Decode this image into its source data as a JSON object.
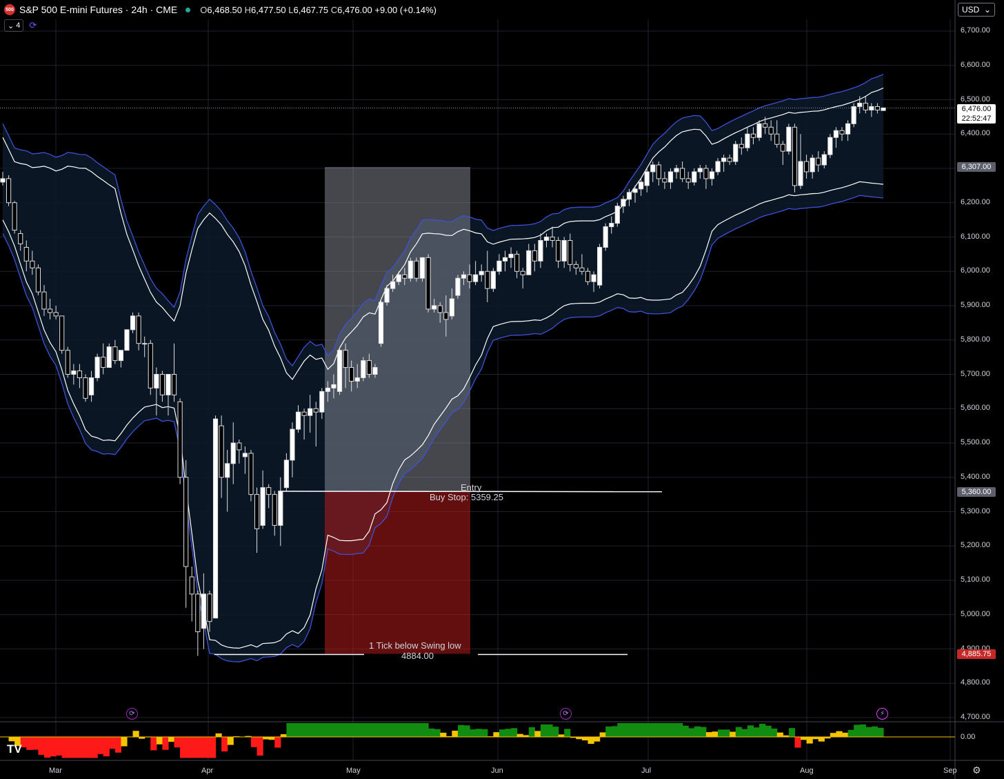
{
  "header": {
    "symbol_badge": "500",
    "title": "S&P 500 E-mini Futures · 24h · CME",
    "ohlc": {
      "o_label": "O",
      "o": "6,468.50",
      "h_label": "H",
      "h": "6,477.50",
      "l_label": "L",
      "l": "6,467.75",
      "c_label": "C",
      "c": "6,476.00",
      "change": "+9.00 (+0.14%)"
    },
    "indicator_count": "4",
    "currency": "USD",
    "up_color": "#ffffff",
    "down_color": "#000000",
    "band_color": "#3f51d8"
  },
  "price_tags": {
    "last_price": "6,476.00",
    "countdown": "22:52:47",
    "level_high": "6,307.00",
    "level_entry": "5,360.00",
    "level_stop": "4,885.75"
  },
  "annotations": {
    "entry_title": "Entry",
    "entry_text": "Buy Stop: 5359.25",
    "stop_title": "1 Tick below Swing low",
    "stop_value": "4884.00"
  },
  "chart_data": {
    "type": "candlestick",
    "title": "S&P 500 E-mini Futures · 24h · CME",
    "ylim": [
      4650,
      6750
    ],
    "yticks": [
      4700,
      4800,
      4900,
      5000,
      5100,
      5200,
      5300,
      5400,
      5500,
      5600,
      5700,
      5800,
      5900,
      6000,
      6100,
      6200,
      6300,
      6400,
      6500,
      6600,
      6700
    ],
    "ytick_labels": [
      "4,700.00",
      "4,800.00",
      "4,900.00",
      "5,000.00",
      "5,100.00",
      "5,200.00",
      "5,300.00",
      "5,400.00",
      "5,500.00",
      "5,600.00",
      "5,700.00",
      "5,800.00",
      "5,900.00",
      "6,000.00",
      "6,100.00",
      "6,200.00",
      "6,300.00",
      "6,400.00",
      "6,500.00",
      "6,600.00",
      "6,700.00"
    ],
    "xtick_labels": [
      "Mar",
      "Apr",
      "May",
      "Jun",
      "Jul",
      "Aug",
      "Sep"
    ],
    "xtick_pos": [
      81,
      302,
      512,
      722,
      940,
      1170,
      1378
    ],
    "candles": [
      [
        6260,
        6290,
        6250,
        6270
      ],
      [
        6270,
        6280,
        6190,
        6200
      ],
      [
        6200,
        6205,
        6110,
        6120
      ],
      [
        6110,
        6120,
        6060,
        6080
      ],
      [
        6070,
        6090,
        6000,
        6030
      ],
      [
        6030,
        6060,
        5990,
        6010
      ],
      [
        6010,
        6020,
        5930,
        5940
      ],
      [
        5940,
        5960,
        5870,
        5890
      ],
      [
        5890,
        5920,
        5860,
        5880
      ],
      [
        5880,
        5900,
        5860,
        5870
      ],
      [
        5870,
        5870,
        5760,
        5770
      ],
      [
        5770,
        5780,
        5690,
        5700
      ],
      [
        5700,
        5730,
        5670,
        5710
      ],
      [
        5710,
        5730,
        5660,
        5690
      ],
      [
        5690,
        5700,
        5620,
        5630
      ],
      [
        5640,
        5710,
        5620,
        5690
      ],
      [
        5690,
        5760,
        5680,
        5750
      ],
      [
        5750,
        5790,
        5700,
        5720
      ],
      [
        5720,
        5790,
        5720,
        5780
      ],
      [
        5780,
        5800,
        5730,
        5740
      ],
      [
        5740,
        5770,
        5720,
        5770
      ],
      [
        5770,
        5830,
        5770,
        5830
      ],
      [
        5830,
        5880,
        5820,
        5870
      ],
      [
        5870,
        5880,
        5770,
        5790
      ],
      [
        5790,
        5810,
        5750,
        5790
      ],
      [
        5790,
        5800,
        5640,
        5660
      ],
      [
        5660,
        5720,
        5580,
        5700
      ],
      [
        5700,
        5710,
        5620,
        5640
      ],
      [
        5640,
        5700,
        5580,
        5700
      ],
      [
        5700,
        5790,
        5620,
        5640
      ],
      [
        5620,
        5630,
        5380,
        5400
      ],
      [
        5400,
        5450,
        5020,
        5140
      ],
      [
        5110,
        5140,
        4980,
        5060
      ],
      [
        5060,
        5070,
        4880,
        4950
      ],
      [
        4960,
        5120,
        4900,
        5060
      ],
      [
        5060,
        5070,
        4950,
        4980
      ],
      [
        4990,
        5580,
        4990,
        5570
      ],
      [
        5550,
        5580,
        5340,
        5400
      ],
      [
        5400,
        5480,
        5300,
        5440
      ],
      [
        5440,
        5560,
        5380,
        5500
      ],
      [
        5500,
        5510,
        5440,
        5480
      ],
      [
        5460,
        5490,
        5410,
        5470
      ],
      [
        5470,
        5480,
        5330,
        5350
      ],
      [
        5350,
        5370,
        5180,
        5250
      ],
      [
        5260,
        5420,
        5250,
        5370
      ],
      [
        5370,
        5380,
        5310,
        5350
      ],
      [
        5350,
        5360,
        5230,
        5260
      ],
      [
        5260,
        5400,
        5200,
        5360
      ],
      [
        5370,
        5470,
        5360,
        5450
      ],
      [
        5450,
        5560,
        5400,
        5540
      ],
      [
        5540,
        5610,
        5530,
        5590
      ],
      [
        5590,
        5600,
        5510,
        5580
      ],
      [
        5580,
        5640,
        5530,
        5600
      ],
      [
        5600,
        5620,
        5490,
        5590
      ],
      [
        5590,
        5660,
        5570,
        5650
      ],
      [
        5650,
        5680,
        5620,
        5660
      ],
      [
        5660,
        5700,
        5630,
        5670
      ],
      [
        5650,
        5780,
        5640,
        5770
      ],
      [
        5770,
        5790,
        5660,
        5720
      ],
      [
        5720,
        5740,
        5650,
        5680
      ],
      [
        5680,
        5730,
        5660,
        5690
      ],
      [
        5690,
        5750,
        5680,
        5740
      ],
      [
        5740,
        5760,
        5690,
        5700
      ],
      [
        5700,
        5730,
        5690,
        5720
      ],
      [
        5790,
        5920,
        5780,
        5910
      ],
      [
        5910,
        5960,
        5900,
        5950
      ],
      [
        5950,
        5990,
        5940,
        5970
      ],
      [
        5970,
        6000,
        5960,
        5990
      ],
      [
        5990,
        6010,
        5960,
        5980
      ],
      [
        5980,
        6040,
        5970,
        6030
      ],
      [
        6030,
        6040,
        5970,
        5980
      ],
      [
        5980,
        6020,
        5970,
        6040
      ],
      [
        6040,
        6050,
        5880,
        5890
      ],
      [
        5890,
        5920,
        5880,
        5900
      ],
      [
        5900,
        5910,
        5850,
        5880
      ],
      [
        5880,
        5930,
        5810,
        5860
      ],
      [
        5870,
        5950,
        5860,
        5920
      ],
      [
        5930,
        5990,
        5920,
        5980
      ],
      [
        5980,
        6000,
        5960,
        5990
      ],
      [
        5990,
        6020,
        5950,
        5970
      ],
      [
        5970,
        6030,
        5960,
        5990
      ],
      [
        5990,
        6020,
        5970,
        6000
      ],
      [
        6000,
        6060,
        5910,
        5950
      ],
      [
        5950,
        6010,
        5940,
        6000
      ],
      [
        6000,
        6050,
        5990,
        6030
      ],
      [
        6030,
        6060,
        6000,
        6040
      ],
      [
        6040,
        6070,
        6010,
        6050
      ],
      [
        6050,
        6060,
        5980,
        6000
      ],
      [
        6000,
        6010,
        5950,
        5990
      ],
      [
        5990,
        6080,
        5990,
        6060
      ],
      [
        6060,
        6080,
        6000,
        6030
      ],
      [
        6030,
        6110,
        6010,
        6090
      ],
      [
        6090,
        6110,
        6070,
        6100
      ],
      [
        6100,
        6130,
        6070,
        6090
      ],
      [
        6090,
        6100,
        6010,
        6030
      ],
      [
        6030,
        6100,
        6010,
        6090
      ],
      [
        6090,
        6110,
        6000,
        6020
      ],
      [
        6020,
        6030,
        5990,
        6010
      ],
      [
        6010,
        6050,
        5990,
        6000
      ],
      [
        6000,
        6010,
        5960,
        5970
      ],
      [
        5970,
        6000,
        5940,
        5990
      ],
      [
        5960,
        6080,
        5950,
        6070
      ],
      [
        6070,
        6140,
        6060,
        6130
      ],
      [
        6130,
        6160,
        6110,
        6140
      ],
      [
        6140,
        6200,
        6130,
        6190
      ],
      [
        6190,
        6220,
        6170,
        6210
      ],
      [
        6210,
        6240,
        6190,
        6230
      ],
      [
        6230,
        6250,
        6200,
        6240
      ],
      [
        6240,
        6270,
        6220,
        6260
      ],
      [
        6250,
        6300,
        6230,
        6290
      ],
      [
        6290,
        6320,
        6260,
        6310
      ],
      [
        6310,
        6320,
        6250,
        6270
      ],
      [
        6270,
        6290,
        6240,
        6260
      ],
      [
        6260,
        6300,
        6240,
        6290
      ],
      [
        6290,
        6310,
        6270,
        6300
      ],
      [
        6300,
        6320,
        6260,
        6270
      ],
      [
        6270,
        6290,
        6240,
        6260
      ],
      [
        6260,
        6300,
        6250,
        6290
      ],
      [
        6290,
        6310,
        6270,
        6300
      ],
      [
        6300,
        6310,
        6240,
        6270
      ],
      [
        6270,
        6300,
        6250,
        6290
      ],
      [
        6290,
        6330,
        6280,
        6320
      ],
      [
        6320,
        6340,
        6290,
        6330
      ],
      [
        6330,
        6340,
        6310,
        6320
      ],
      [
        6320,
        6380,
        6310,
        6370
      ],
      [
        6370,
        6390,
        6340,
        6360
      ],
      [
        6360,
        6420,
        6350,
        6400
      ],
      [
        6400,
        6420,
        6370,
        6390
      ],
      [
        6390,
        6440,
        6380,
        6430
      ],
      [
        6430,
        6450,
        6400,
        6420
      ],
      [
        6420,
        6440,
        6380,
        6400
      ],
      [
        6400,
        6440,
        6360,
        6370
      ],
      [
        6370,
        6380,
        6310,
        6350
      ],
      [
        6350,
        6430,
        6340,
        6420
      ],
      [
        6420,
        6430,
        6230,
        6250
      ],
      [
        6250,
        6400,
        6240,
        6320
      ],
      [
        6320,
        6340,
        6270,
        6290
      ],
      [
        6290,
        6340,
        6270,
        6330
      ],
      [
        6330,
        6350,
        6290,
        6310
      ],
      [
        6310,
        6350,
        6300,
        6340
      ],
      [
        6340,
        6400,
        6330,
        6390
      ],
      [
        6390,
        6420,
        6360,
        6410
      ],
      [
        6410,
        6420,
        6380,
        6400
      ],
      [
        6400,
        6440,
        6380,
        6430
      ],
      [
        6430,
        6490,
        6420,
        6480
      ],
      [
        6480,
        6510,
        6460,
        6490
      ],
      [
        6490,
        6510,
        6460,
        6470
      ],
      [
        6470,
        6490,
        6450,
        6480
      ],
      [
        6480,
        6490,
        6460,
        6470
      ],
      [
        6468.5,
        6477.5,
        6467.75,
        6476
      ]
    ]
  },
  "oscillator": {
    "zero_label": "0.00"
  }
}
